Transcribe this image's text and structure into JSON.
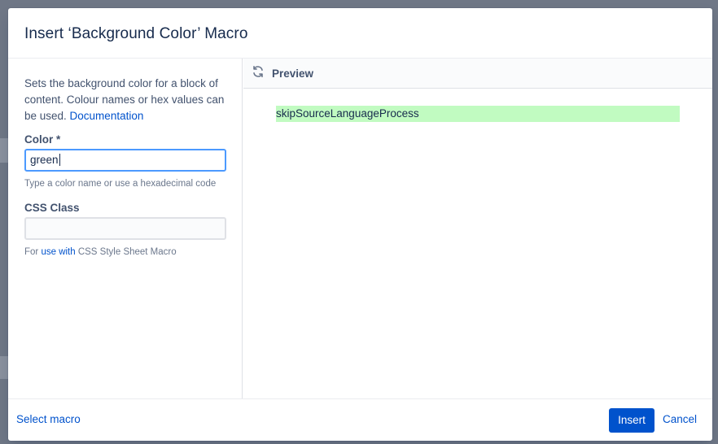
{
  "dialog": {
    "title": "Insert ‘Background Color’ Macro"
  },
  "left_panel": {
    "description_text": "Sets the background color for a block of content. Colour names or hex values can be used. ",
    "documentation_link": "Documentation",
    "color_field": {
      "label": "Color *",
      "value": "green",
      "hint": "Type a color name or use a hexadecimal code"
    },
    "css_class_field": {
      "label": "CSS Class",
      "value": "",
      "hint_prefix": "For ",
      "hint_link": "use with",
      "hint_suffix": " CSS Style Sheet Macro"
    }
  },
  "preview": {
    "label": "Preview",
    "icon": "refresh-icon",
    "content_text": "skipSourceLanguageProcess",
    "content_background": "#c1fbc1"
  },
  "footer": {
    "select_macro": "Select macro",
    "insert": "Insert",
    "cancel": "Cancel"
  },
  "colors": {
    "accent": "#0052cc",
    "focus_border": "#4c9aff"
  }
}
